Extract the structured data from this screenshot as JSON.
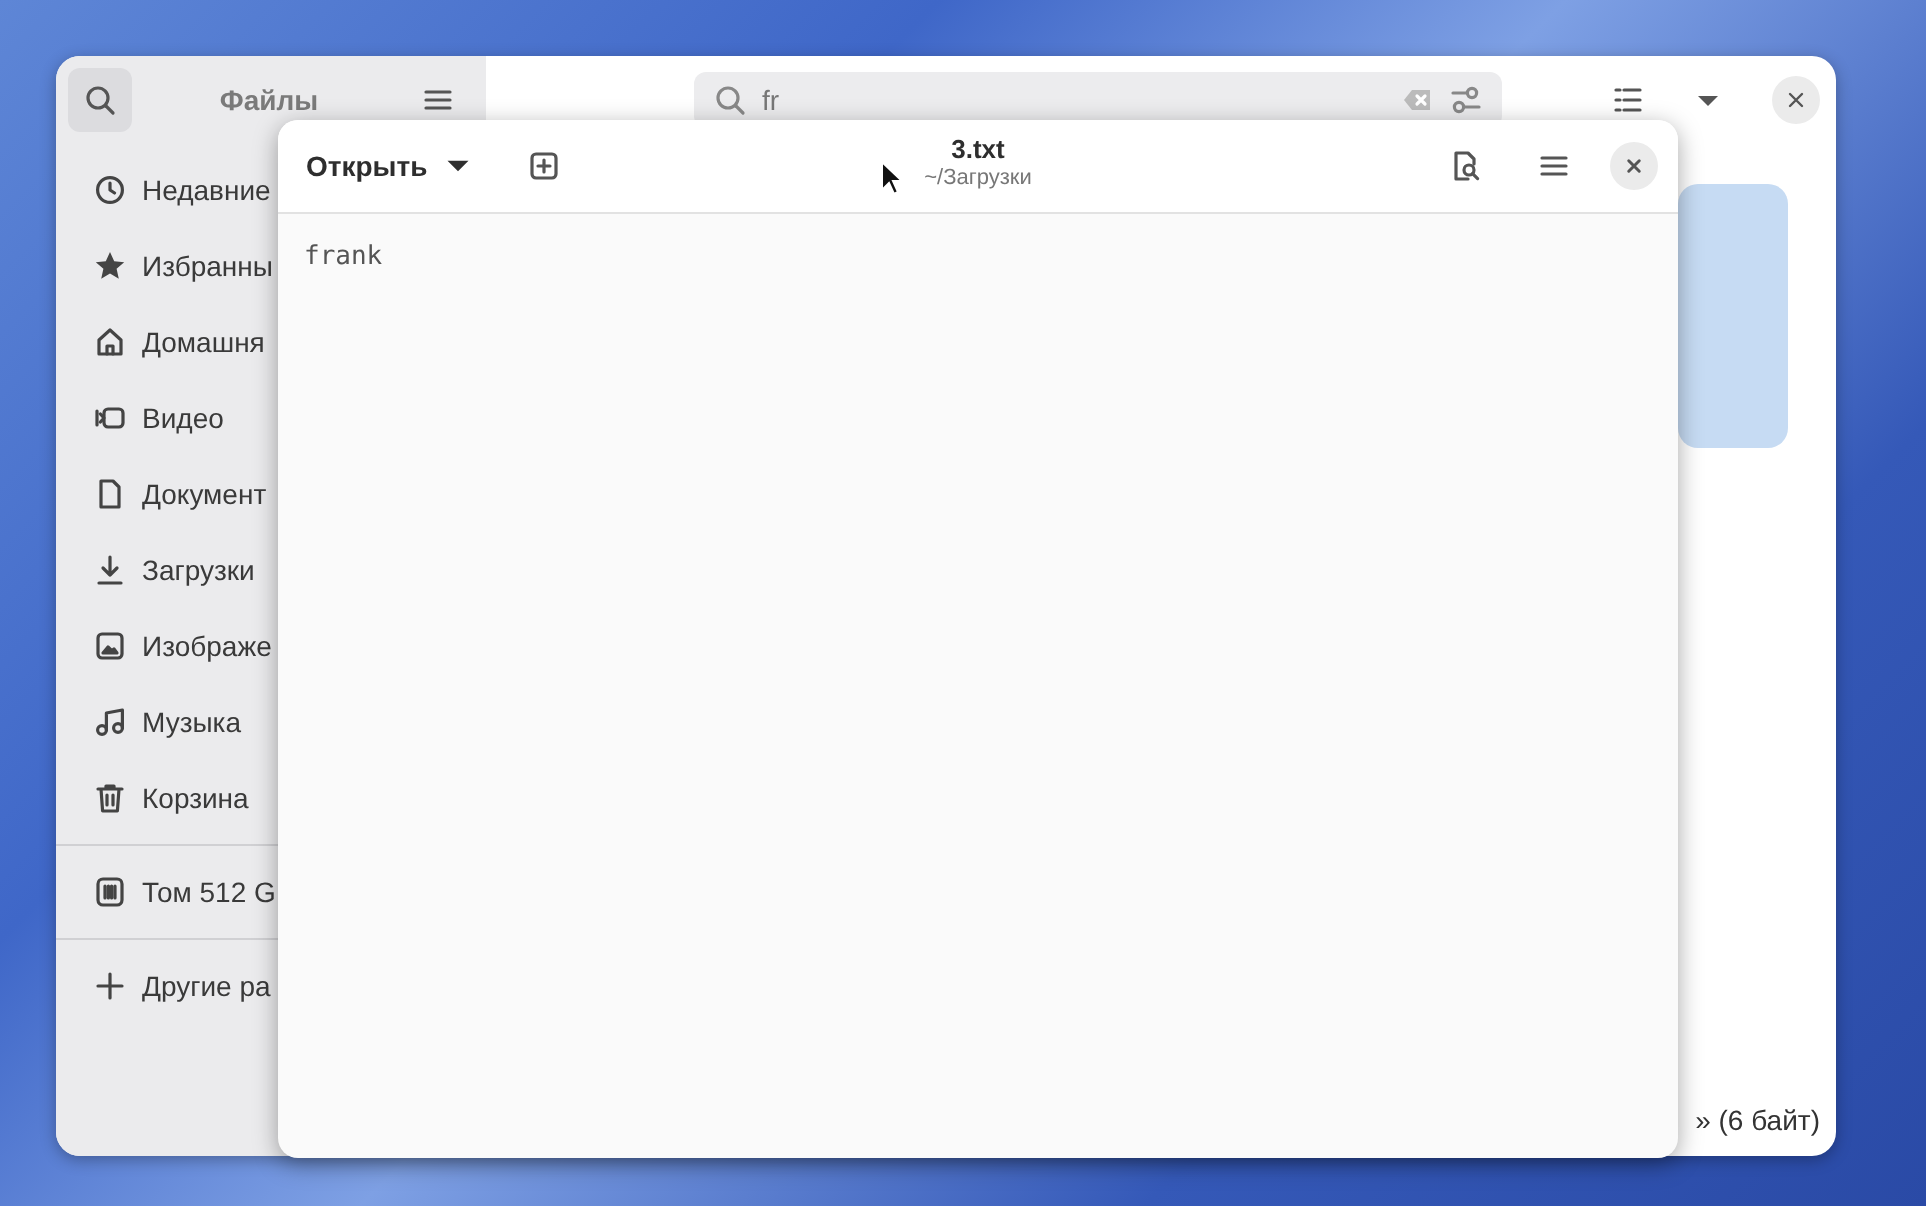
{
  "files_window": {
    "title": "Файлы",
    "search": {
      "value": "fr"
    },
    "sidebar": {
      "groups": [
        [
          {
            "label": "Недавние"
          },
          {
            "label": "Избранны"
          },
          {
            "label": "Домашня"
          },
          {
            "label": "Видео"
          },
          {
            "label": "Документ"
          },
          {
            "label": "Загрузки"
          },
          {
            "label": "Изображе"
          },
          {
            "label": "Музыка"
          },
          {
            "label": "Корзина"
          }
        ],
        [
          {
            "label": "Том 512 G"
          }
        ],
        [
          {
            "label": "Другие ра"
          }
        ]
      ]
    },
    "status_bar": "» (6 байт)"
  },
  "editor_window": {
    "open_button": "Открыть",
    "title": "3.txt",
    "subtitle": "~/Загрузки",
    "content": "frank"
  }
}
